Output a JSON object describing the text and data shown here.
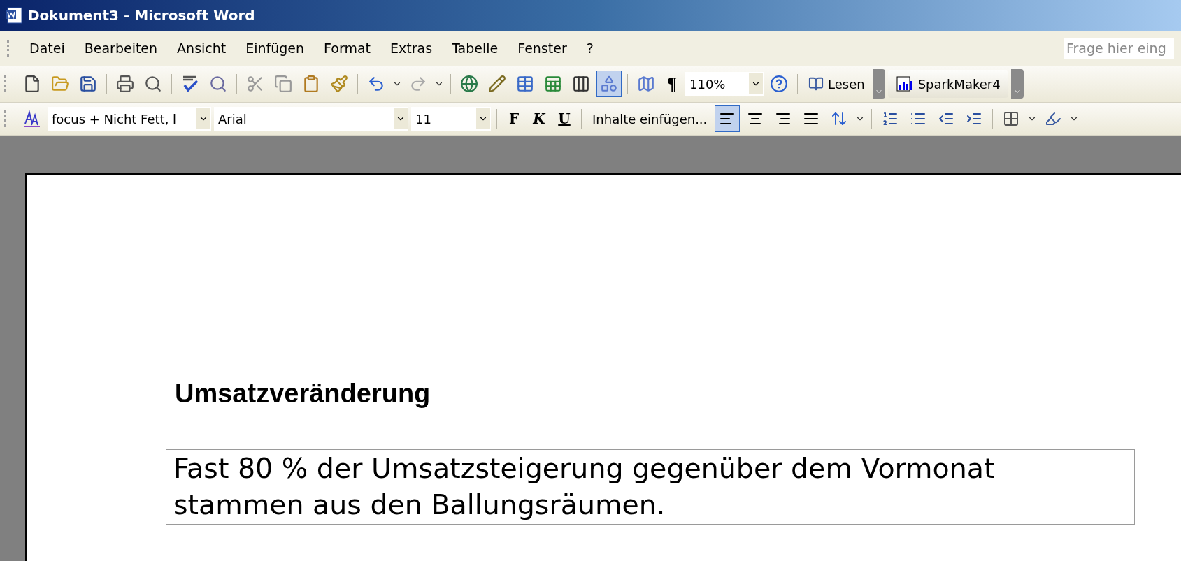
{
  "window": {
    "title": "Dokument3 - Microsoft Word"
  },
  "menu": [
    "Datei",
    "Bearbeiten",
    "Ansicht",
    "Einfügen",
    "Format",
    "Extras",
    "Tabelle",
    "Fenster",
    "?"
  ],
  "help_box": {
    "placeholder": "Frage hier eing"
  },
  "standard_toolbar": {
    "buttons": [
      {
        "pressed": false
      },
      {
        "pressed": false
      },
      {
        "pressed": false
      },
      {
        "pressed": false
      },
      {
        "pressed": false
      },
      {
        "pressed": false
      },
      {
        "pressed": false
      },
      {
        "pressed": false
      },
      {
        "pressed": false
      },
      {
        "pressed": false
      },
      {
        "pressed": false
      },
      {
        "pressed": false
      },
      {
        "pressed": false
      },
      {
        "pressed": false
      },
      {
        "pressed": false
      },
      {
        "pressed": false
      },
      {
        "pressed": false
      },
      {
        "pressed": false
      },
      {
        "pressed": true
      },
      {
        "pressed": false
      },
      {
        "pressed": false
      }
    ],
    "pilcrow": "¶",
    "zoom": "110%",
    "read_button": "Lesen"
  },
  "sparkmaker_toolbar": {
    "button": "SparkMaker4"
  },
  "format_toolbar": {
    "style": "focus + Nicht Fett, l",
    "font": "Arial",
    "size": "11",
    "font_style_buttons": [
      "F",
      "K",
      "U"
    ],
    "paste_button": "Inhalte einfügen...",
    "alignments": [
      {
        "selected": true
      },
      {
        "selected": false
      },
      {
        "selected": false
      },
      {
        "selected": false
      }
    ]
  },
  "document": {
    "heading": "Umsatzveränderung",
    "text_box": "Fast 80 % der Umsatzsteigerung gegenüber dem Vormonat stammen aus den Ballungsräumen."
  }
}
